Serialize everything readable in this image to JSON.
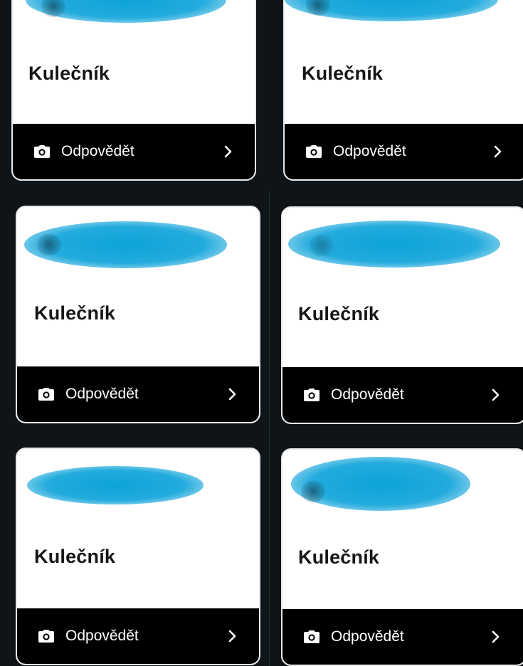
{
  "cards": [
    {
      "title": "Kulečník",
      "reply_label": "Odpovědět",
      "camera_icon": "camera-icon",
      "chevron_icon": "chevron-right-icon"
    },
    {
      "title": "Kulečník",
      "reply_label": "Odpovědět",
      "camera_icon": "camera-icon",
      "chevron_icon": "chevron-right-icon"
    },
    {
      "title": "Kulečník",
      "reply_label": "Odpovědět",
      "camera_icon": "camera-icon",
      "chevron_icon": "chevron-right-icon"
    },
    {
      "title": "Kulečník",
      "reply_label": "Odpovědět",
      "camera_icon": "camera-icon",
      "chevron_icon": "chevron-right-icon"
    },
    {
      "title": "Kulečník",
      "reply_label": "Odpovědět",
      "camera_icon": "camera-icon",
      "chevron_icon": "chevron-right-icon"
    },
    {
      "title": "Kulečník",
      "reply_label": "Odpovědět",
      "camera_icon": "camera-icon",
      "chevron_icon": "chevron-right-icon"
    }
  ],
  "colors": {
    "background": "#0f1418",
    "card": "#ffffff",
    "reply_bar": "#000000",
    "redaction": "#0a9fd6"
  }
}
